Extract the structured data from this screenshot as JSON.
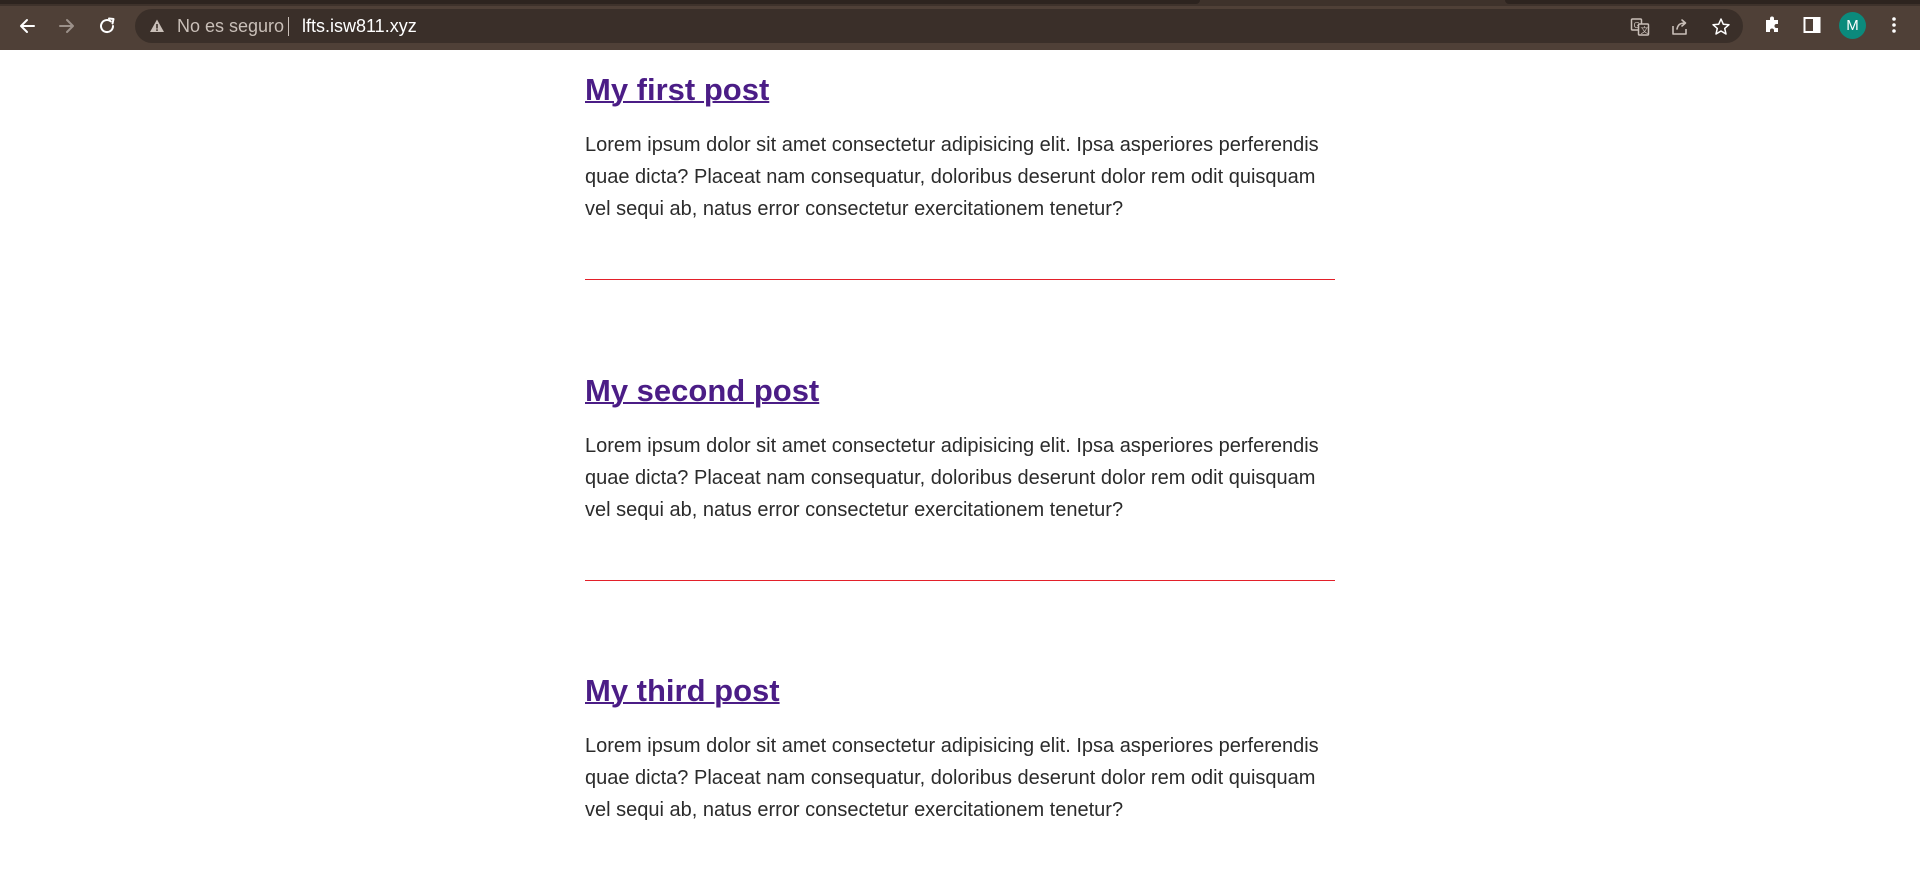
{
  "browser": {
    "security_label": "No es seguro",
    "url": "lfts.isw811.xyz",
    "profile_initial": "M",
    "icons": [
      "back-icon",
      "forward-icon",
      "reload-icon",
      "warning-icon",
      "translate-icon",
      "share-icon",
      "star-icon",
      "extensions-icon",
      "side-panel-icon",
      "menu-icon"
    ]
  },
  "posts": [
    {
      "title": "My first post",
      "body": "Lorem ipsum dolor sit amet consectetur adipisicing elit. Ipsa asperiores perferendis quae dicta? Placeat nam consequatur, doloribus deserunt dolor rem odit quisquam vel sequi ab, natus error consectetur exercitationem tenetur?"
    },
    {
      "title": "My second post",
      "body": "Lorem ipsum dolor sit amet consectetur adipisicing elit. Ipsa asperiores perferendis quae dicta? Placeat nam consequatur, doloribus deserunt dolor rem odit quisquam vel sequi ab, natus error consectetur exercitationem tenetur?"
    },
    {
      "title": "My third post",
      "body": "Lorem ipsum dolor sit amet consectetur adipisicing elit. Ipsa asperiores perferendis quae dicta? Placeat nam consequatur, doloribus deserunt dolor rem odit quisquam vel sequi ab, natus error consectetur exercitationem tenetur?"
    }
  ],
  "colors": {
    "chrome_bg": "#4f4037",
    "omnibox_bg": "#3a2f29",
    "link": "#4b1d86",
    "divider": "#e3202a",
    "avatar": "#0b8a7c"
  }
}
